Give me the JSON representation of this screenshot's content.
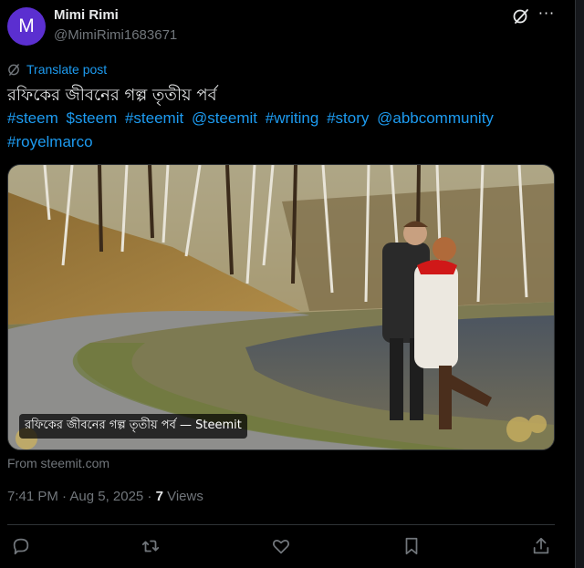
{
  "author": {
    "avatar_letter": "M",
    "name": "Mimi Rimi",
    "handle": "@MimiRimi1683671"
  },
  "translate_label": "Translate post",
  "post_title": "রফিকের জীবনের গল্প তৃতীয় পর্ব",
  "hashtags": [
    "#steem",
    "$steem",
    "#steemit",
    "@steemit",
    "#writing",
    "#story",
    "@abbcommunity",
    "#royelmarco"
  ],
  "card": {
    "caption": "রফিকের জীবনের গল্প তৃতীয় পর্ব — Steemit",
    "source": "From steemit.com"
  },
  "meta": {
    "datetime": "7:41 PM · Aug 5, 2025 · ",
    "views_count": "7",
    "views_label": " Views"
  },
  "icons": {
    "grok": "grok-icon",
    "more": "more-icon",
    "reply": "reply-icon",
    "repost": "repost-icon",
    "like": "like-icon",
    "bookmark": "bookmark-icon",
    "share": "share-icon"
  },
  "colors": {
    "background": "#000000",
    "accent": "#1d9bf0",
    "muted": "#71767b",
    "avatar": "#5b2fd0"
  }
}
